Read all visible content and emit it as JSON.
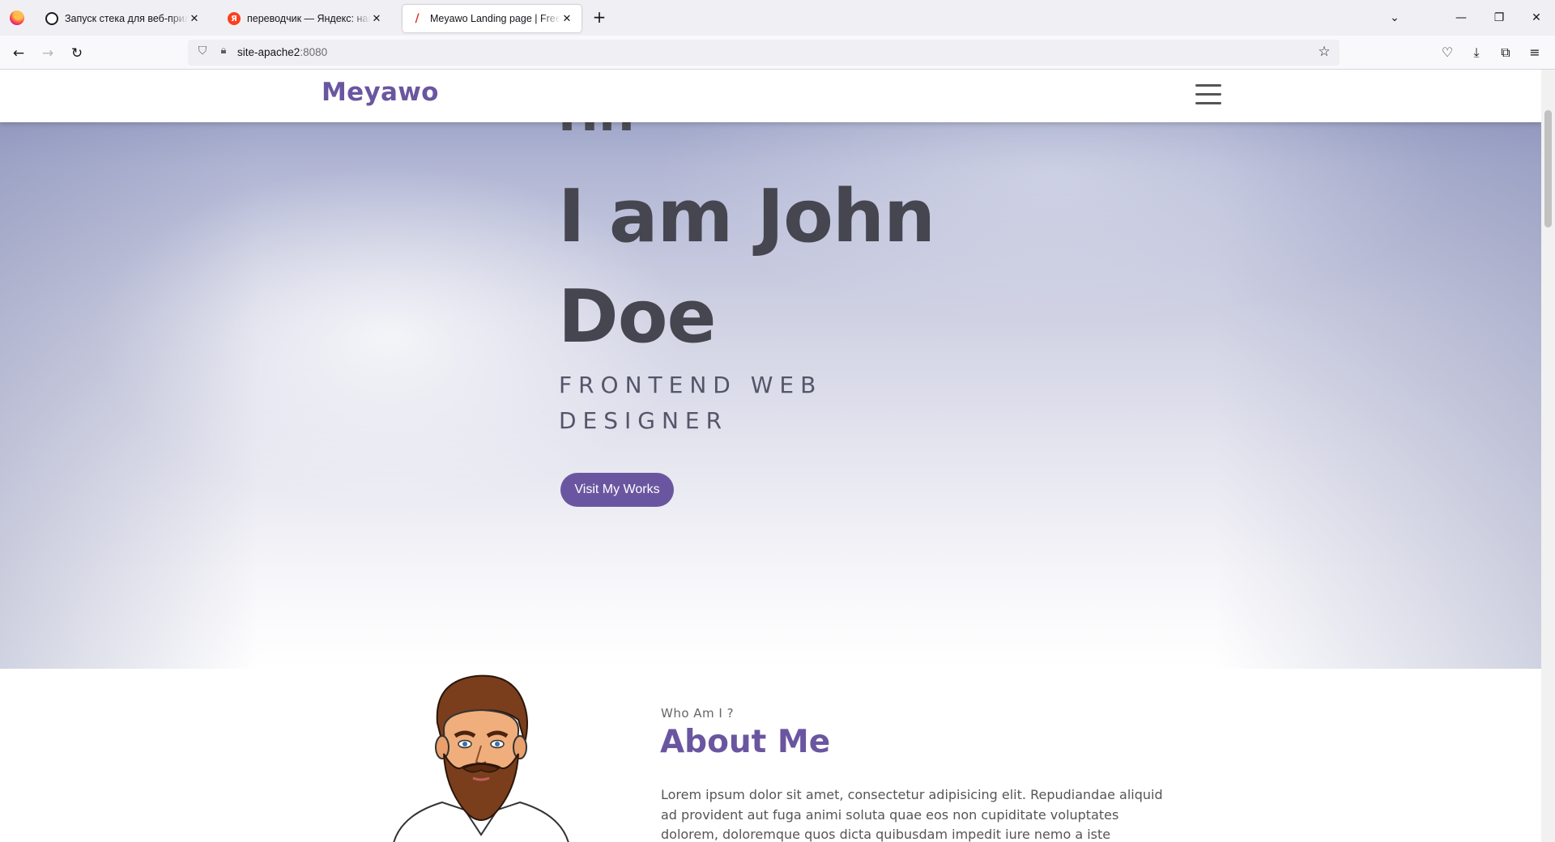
{
  "browser": {
    "tabs": [
      {
        "title": "Запуск стека для веб-приложения",
        "favicon": "chatgpt-icon",
        "active": false
      },
      {
        "title": "переводчик — Яндекс: нашлось",
        "favicon": "yandex-icon",
        "active": false
      },
      {
        "title": "Meyawo Landing page | Free Bootstrap",
        "favicon": "feather-icon",
        "active": true
      }
    ],
    "url_host": "site-apache2",
    "url_port": ":8080"
  },
  "site": {
    "brand": "Meyawo",
    "hero": {
      "greeting": "Hi!",
      "name": "I am John Doe",
      "role": "FRONTEND WEB DESIGNER",
      "cta": "Visit My Works"
    },
    "about": {
      "kicker": "Who Am I ?",
      "title": "About Me",
      "text": "Lorem ipsum dolor sit amet, consectetur adipisicing elit. Repudiandae aliquid ad provident aut fuga animi soluta quae eos non cupiditate voluptates dolorem, doloremque quos dicta quibusdam impedit iure nemo a iste"
    },
    "colors": {
      "accent": "#6a56a0",
      "heading": "#464650"
    }
  }
}
